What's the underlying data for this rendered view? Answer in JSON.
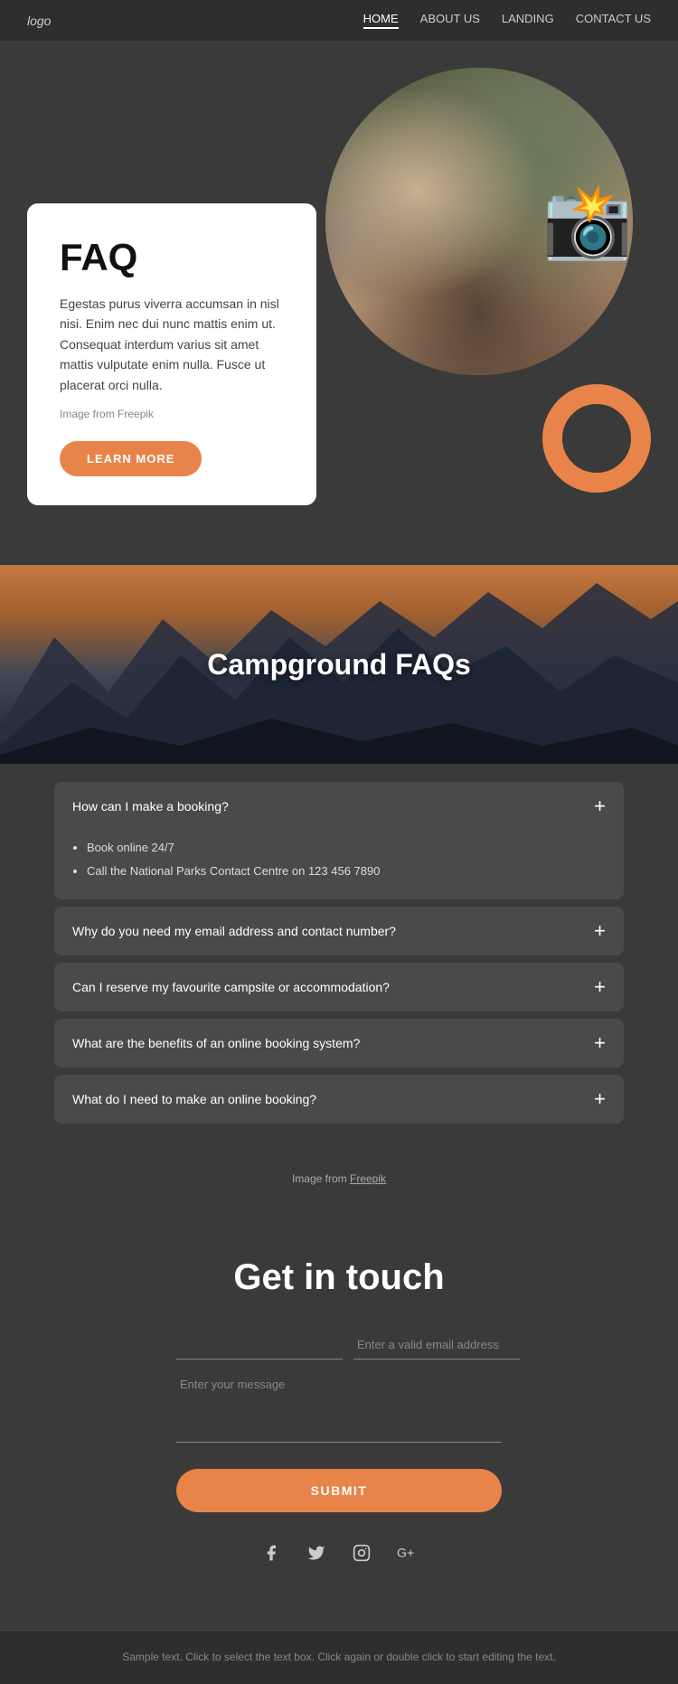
{
  "nav": {
    "logo": "logo",
    "links": [
      {
        "label": "HOME",
        "active": true
      },
      {
        "label": "ABOUT US",
        "active": false
      },
      {
        "label": "LANDING",
        "active": false
      },
      {
        "label": "CONTACT US",
        "active": false
      }
    ]
  },
  "hero": {
    "faq_title": "FAQ",
    "faq_body": "Egestas purus viverra accumsan in nisl nisi. Enim nec dui nunc mattis enim ut. Consequat interdum varius sit amet mattis vulputate enim nulla. Fusce ut placerat orci nulla.",
    "image_credit": "Image from Freepik",
    "learn_more_label": "LEARN MORE"
  },
  "campground_faqs": {
    "title": "Campground FAQs",
    "items": [
      {
        "question": "How can I make a booking?",
        "expanded": true,
        "answer_list": [
          "Book online 24/7",
          "Call the National Parks Contact Centre on 123 456 7890"
        ]
      },
      {
        "question": "Why do you need my email address and contact number?",
        "expanded": false,
        "answer_list": []
      },
      {
        "question": "Can I reserve my favourite campsite or accommodation?",
        "expanded": false,
        "answer_list": []
      },
      {
        "question": "What are the benefits of an online booking system?",
        "expanded": false,
        "answer_list": []
      },
      {
        "question": "What do I need to make an online booking?",
        "expanded": false,
        "answer_list": []
      }
    ],
    "image_attribution": "Image from",
    "image_attribution_link": "Freepik"
  },
  "contact": {
    "title": "Get in touch",
    "name_placeholder": "",
    "email_placeholder": "Enter a valid email address",
    "message_placeholder": "Enter your message",
    "submit_label": "SUBMIT"
  },
  "social": {
    "icons": [
      "f",
      "t",
      "ig",
      "g+"
    ]
  },
  "footer": {
    "text": "Sample text. Click to select the text box. Click again or double click to start editing the text."
  }
}
